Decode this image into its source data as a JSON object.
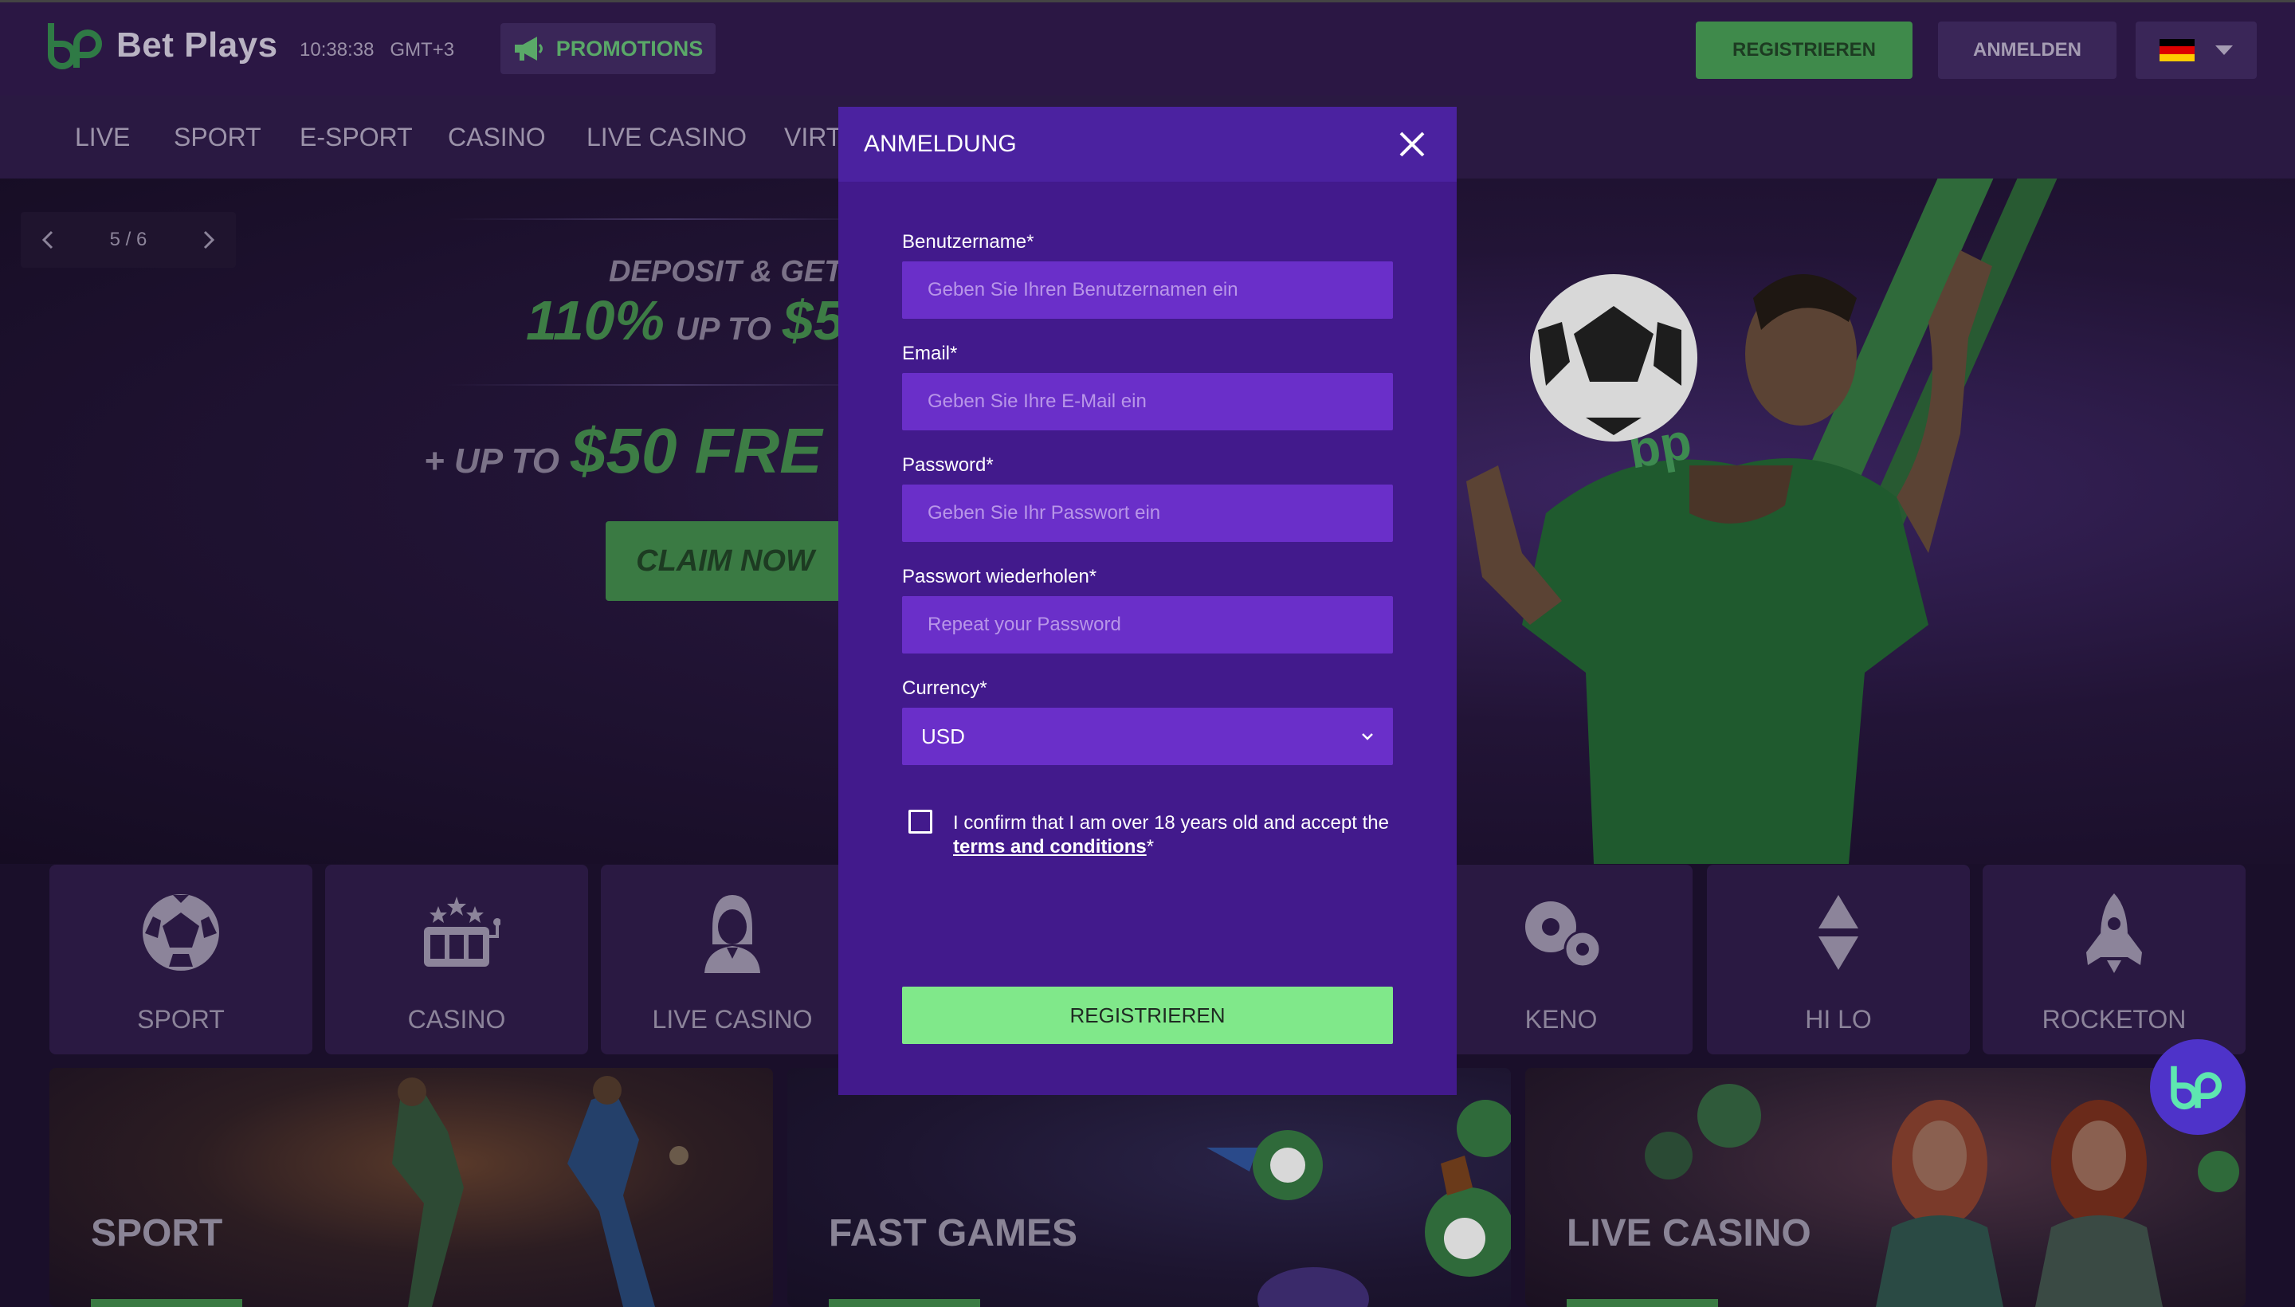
{
  "header": {
    "brand": "Bet Plays",
    "clock": "10:38:38   GMT+3",
    "promotions_label": "PROMOTIONS",
    "register_label": "REGISTRIEREN",
    "login_label": "ANMELDEN",
    "language_flag": "de-flag-icon"
  },
  "nav": {
    "items": [
      "LIVE",
      "SPORT",
      "E-SPORT",
      "CASINO",
      "LIVE CASINO",
      "VIRT"
    ]
  },
  "banner": {
    "slide_counter": "5 / 6",
    "deposit_text": "DEPOSIT & GET",
    "percent": "110%",
    "up_to_1": "UP TO",
    "amount_1": "$5",
    "plus_up_to": "+ UP TO",
    "amount_2": "$50 FRE",
    "cta": "CLAIM NOW"
  },
  "tiles": [
    {
      "label": "SPORT",
      "icon": "soccer-ball-icon"
    },
    {
      "label": "CASINO",
      "icon": "slot-machine-icon"
    },
    {
      "label": "LIVE CASINO",
      "icon": "dealer-icon"
    },
    {
      "label": "KENO",
      "icon": "keno-balls-icon"
    },
    {
      "label": "HI LO",
      "icon": "hi-lo-arrows-icon"
    },
    {
      "label": "ROCKETON",
      "icon": "rocket-icon"
    }
  ],
  "cards": [
    {
      "title": "SPORT"
    },
    {
      "title": "FAST GAMES"
    },
    {
      "title": "LIVE CASINO"
    }
  ],
  "modal": {
    "title": "ANMELDUNG",
    "username": {
      "label": "Benutzername*",
      "placeholder": "Geben Sie Ihren Benutzernamen ein"
    },
    "email": {
      "label": "Email*",
      "placeholder": "Geben Sie Ihre E-Mail ein"
    },
    "password": {
      "label": "Password*",
      "placeholder": "Geben Sie Ihr Passwort ein"
    },
    "password_repeat": {
      "label": "Passwort wiederholen*",
      "placeholder": "Repeat your Password"
    },
    "currency": {
      "label": "Currency*",
      "value": "USD"
    },
    "confirm_text": "I confirm that I am over 18 years old and accept the",
    "terms_link": "terms and conditions",
    "terms_suffix": "*",
    "submit_label": "REGISTRIEREN"
  },
  "colors": {
    "accent_green": "#80e88a",
    "modal_bg": "#421a8c",
    "input_bg": "#6a2fc9",
    "header_bg": "#2b1744"
  }
}
